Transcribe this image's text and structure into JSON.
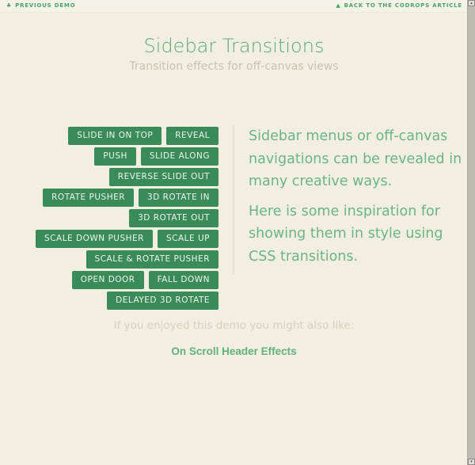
{
  "topbar": {
    "previous_demo": {
      "icon": "arrow-left-icon",
      "glyph": "❘",
      "label": "Previous Demo"
    },
    "back_to_article": {
      "icon": "drop-icon",
      "glyph": "▲",
      "label": "Back to the Codrops Article"
    }
  },
  "header": {
    "title": "Sidebar Transitions",
    "subtitle": "Transition effects for off-canvas views"
  },
  "buttons": [
    "Slide in on top",
    "Reveal",
    "Push",
    "Slide along",
    "Reverse slide out",
    "Rotate pusher",
    "3D rotate in",
    "3D rotate out",
    "Scale down pusher",
    "Scale up",
    "Scale & rotate pusher",
    "Open door",
    "Fall down",
    "Delayed 3D rotate"
  ],
  "description": {
    "p1": "Sidebar menus or off-canvas navigations can be revealed in many creative ways.",
    "p2": "Here is some inspiration for showing them in style using CSS transitions."
  },
  "related": {
    "label": "If you enjoyed this demo you might also like:",
    "link": "On Scroll Header Effects"
  },
  "colors": {
    "accent": "#3a8a5a",
    "background": "#f2efe2",
    "text_green": "#6cb488"
  }
}
